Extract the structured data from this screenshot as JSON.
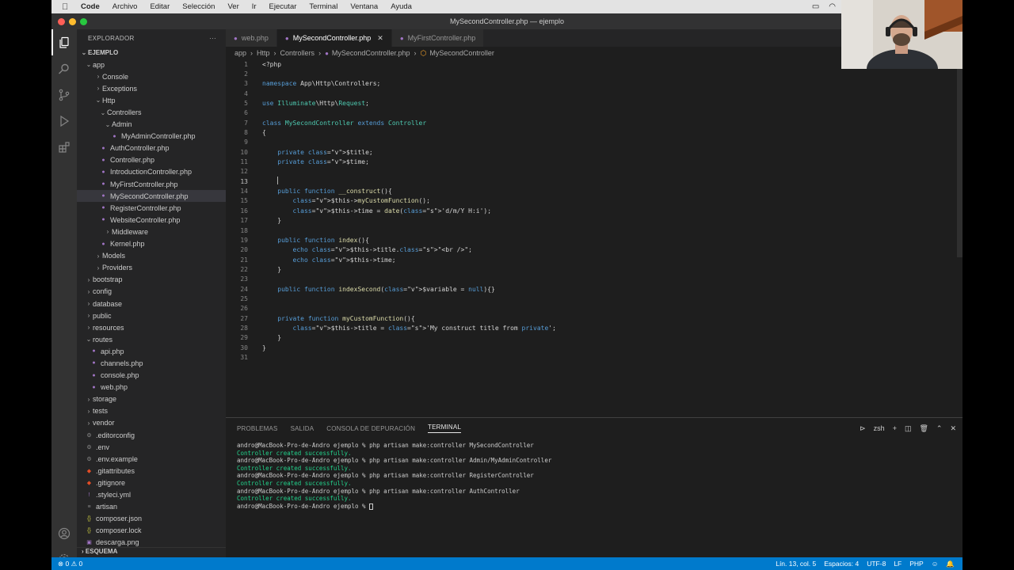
{
  "menubar": {
    "app": "Code",
    "items": [
      "Archivo",
      "Editar",
      "Selección",
      "Ver",
      "Ir",
      "Ejecutar",
      "Terminal",
      "Ventana",
      "Ayuda"
    ]
  },
  "window": {
    "title": "MySecondController.php — ejemplo"
  },
  "sidebar": {
    "title": "EXPLORADOR",
    "root": "EJEMPLO",
    "tree": [
      {
        "label": "app",
        "kind": "folder-open"
      },
      {
        "label": "Console",
        "kind": "folder"
      },
      {
        "label": "Exceptions",
        "kind": "folder"
      },
      {
        "label": "Http",
        "kind": "folder-open"
      },
      {
        "label": "Controllers",
        "kind": "folder-open"
      },
      {
        "label": "Admin",
        "kind": "folder-open"
      },
      {
        "label": "MyAdminController.php",
        "kind": "php"
      },
      {
        "label": "AuthController.php",
        "kind": "php"
      },
      {
        "label": "Controller.php",
        "kind": "php"
      },
      {
        "label": "IntroductionController.php",
        "kind": "php"
      },
      {
        "label": "MyFirstController.php",
        "kind": "php"
      },
      {
        "label": "MySecondController.php",
        "kind": "php",
        "selected": true
      },
      {
        "label": "RegisterController.php",
        "kind": "php"
      },
      {
        "label": "WebsiteController.php",
        "kind": "php"
      },
      {
        "label": "Middleware",
        "kind": "folder"
      },
      {
        "label": "Kernel.php",
        "kind": "php"
      },
      {
        "label": "Models",
        "kind": "folder"
      },
      {
        "label": "Providers",
        "kind": "folder"
      },
      {
        "label": "bootstrap",
        "kind": "folder"
      },
      {
        "label": "config",
        "kind": "folder"
      },
      {
        "label": "database",
        "kind": "folder"
      },
      {
        "label": "public",
        "kind": "folder"
      },
      {
        "label": "resources",
        "kind": "folder"
      },
      {
        "label": "routes",
        "kind": "folder-open"
      },
      {
        "label": "api.php",
        "kind": "php"
      },
      {
        "label": "channels.php",
        "kind": "php"
      },
      {
        "label": "console.php",
        "kind": "php"
      },
      {
        "label": "web.php",
        "kind": "php"
      },
      {
        "label": "storage",
        "kind": "folder"
      },
      {
        "label": "tests",
        "kind": "folder"
      },
      {
        "label": "vendor",
        "kind": "folder"
      },
      {
        "label": ".editorconfig",
        "kind": "gear"
      },
      {
        "label": ".env",
        "kind": "gear"
      },
      {
        "label": ".env.example",
        "kind": "gear"
      },
      {
        "label": ".gitattributes",
        "kind": "git"
      },
      {
        "label": ".gitignore",
        "kind": "git"
      },
      {
        "label": ".styleci.yml",
        "kind": "yml"
      },
      {
        "label": "artisan",
        "kind": "file"
      },
      {
        "label": "composer.json",
        "kind": "json"
      },
      {
        "label": "composer.lock",
        "kind": "json"
      },
      {
        "label": "descarga.png",
        "kind": "img"
      }
    ],
    "footer": "ESQUEMA"
  },
  "tabs": [
    {
      "label": "web.php",
      "active": false
    },
    {
      "label": "MySecondController.php",
      "active": true
    },
    {
      "label": "MyFirstController.php",
      "active": false
    }
  ],
  "breadcrumb": [
    "app",
    "Http",
    "Controllers",
    "MySecondController.php",
    "MySecondController"
  ],
  "code": {
    "current_line": 13,
    "lines": [
      "<?php",
      "",
      "namespace App\\Http\\Controllers;",
      "",
      "use Illuminate\\Http\\Request;",
      "",
      "class MySecondController extends Controller",
      "{",
      "",
      "    private $title;",
      "    private $time;",
      "",
      "    ",
      "    public function __construct(){",
      "        $this->myCustomFunction();",
      "        $this->time = date('d/m/Y H:i');",
      "    }",
      "",
      "    public function index(){",
      "        echo $this->title.\"<br />\";",
      "        echo $this->time;",
      "    }",
      "",
      "    public function indexSecond($variable = null){}",
      "",
      "",
      "    private function myCustomFunction(){",
      "        $this->title = 'My construct title from private';",
      "    }",
      "}",
      ""
    ]
  },
  "panel": {
    "tabs": [
      "PROBLEMAS",
      "SALIDA",
      "CONSOLA DE DEPURACIÓN",
      "TERMINAL"
    ],
    "active_tab": "TERMINAL",
    "shell": "zsh",
    "terminal": [
      {
        "text": "andro@MacBook-Pro-de-Andro ejemplo % php artisan make:controller MySecondController",
        "ok": false
      },
      {
        "text": "Controller created successfully.",
        "ok": true
      },
      {
        "text": "andro@MacBook-Pro-de-Andro ejemplo % php artisan make:controller Admin/MyAdminController",
        "ok": false
      },
      {
        "text": "Controller created successfully.",
        "ok": true
      },
      {
        "text": "andro@MacBook-Pro-de-Andro ejemplo % php artisan make:controller RegisterController",
        "ok": false
      },
      {
        "text": "Controller created successfully.",
        "ok": true
      },
      {
        "text": "andro@MacBook-Pro-de-Andro ejemplo % php artisan make:controller AuthController",
        "ok": false
      },
      {
        "text": "Controller created successfully.",
        "ok": true
      },
      {
        "text": "andro@MacBook-Pro-de-Andro ejemplo % ",
        "ok": false,
        "cursor": true
      }
    ]
  },
  "statusbar": {
    "left": "⊗ 0 ⚠ 0",
    "position": "Lín. 13, col. 5",
    "spaces": "Espacios: 4",
    "encoding": "UTF-8",
    "eol": "LF",
    "language": "PHP"
  },
  "colors": {
    "accent": "#007acc",
    "php_icon": "#a074c4",
    "success": "#23d18b"
  }
}
